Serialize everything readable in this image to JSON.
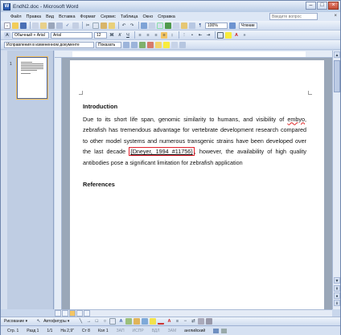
{
  "window": {
    "title": "EndN2.doc - Microsoft Word",
    "app_icon": "W"
  },
  "menubar": {
    "items": [
      "Файл",
      "Правка",
      "Вид",
      "Вставка",
      "Формат",
      "Сервис",
      "Таблица",
      "Окно",
      "Справка"
    ],
    "ask_placeholder": "Введите вопрос",
    "close_glyph": "×"
  },
  "toolbar1": {
    "zoom": "100%",
    "read_label": "Чтение"
  },
  "toolbar2": {
    "style": "Обычный + Arial",
    "font": "Arial",
    "size": "12"
  },
  "toolbar3": {
    "markup_mode": "Исправления в измененном документе",
    "show_label": "Показать"
  },
  "thumbnails": {
    "page_number": "1"
  },
  "document": {
    "heading": "Introduction",
    "p1_a": "Due to its short life span, genomic similarity to humans, and visibility of ",
    "p1_misspelled": "embyo",
    "p1_b": ", zebrafish has tremendous advantage for vertebrate development research compared to other model systems and numerous transgenic strains have been developed over the last decade ",
    "citation": "{Dneyer, 1994 #11756}",
    "p1_c": ", however, the availability of high quality antibodies pose a significant limitation for zebrafish application",
    "references_heading": "References"
  },
  "drawbar": {
    "drawing_label": "Рисование ▾",
    "autoshapes_label": "Автофигуры ▾"
  },
  "statusbar": {
    "page": "Стр. 1",
    "section": "Разд 1",
    "pages": "1/1",
    "at": "На 2,9\"",
    "line": "Ст 8",
    "col": "Кол 1",
    "rec": "ЗАП",
    "trk": "ИСПР",
    "ext": "ВДЛ",
    "ovr": "ЗАМ",
    "language": "английский"
  },
  "colors": {
    "citation_box": "#e0202c",
    "title_gradient_top": "#e9f0fa",
    "page_bg": "#ffffff"
  }
}
